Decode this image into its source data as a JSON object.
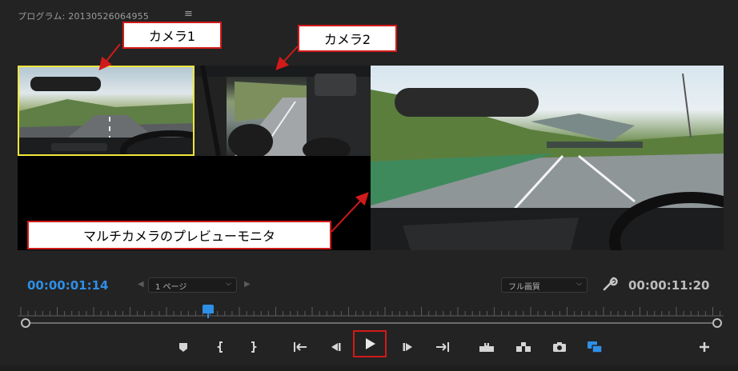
{
  "panel": {
    "title": "プログラム: 20130526064955",
    "menu_icon": "hamburger-menu-icon"
  },
  "callouts": {
    "camera1": "カメラ1",
    "camera2": "カメラ2",
    "multicam_preview": "マルチカメラのプレビューモニタ"
  },
  "timecode": {
    "current": "00:00:01:14",
    "duration": "00:00:11:20"
  },
  "page_select": {
    "value": "1 ページ"
  },
  "quality_select": {
    "value": "フル画質"
  },
  "playhead": {
    "position_fraction": 0.27
  },
  "controls": [
    {
      "name": "add-marker-button",
      "icon": "marker-icon"
    },
    {
      "name": "mark-in-button",
      "icon": "mark-in-icon"
    },
    {
      "name": "mark-out-button",
      "icon": "mark-out-icon"
    },
    {
      "name": "go-to-in-button",
      "icon": "go-to-in-icon"
    },
    {
      "name": "step-back-button",
      "icon": "step-back-icon"
    },
    {
      "name": "play-button",
      "icon": "play-icon",
      "highlighted": true
    },
    {
      "name": "step-forward-button",
      "icon": "step-forward-icon"
    },
    {
      "name": "go-to-out-button",
      "icon": "go-to-out-icon"
    },
    {
      "name": "lift-button",
      "icon": "lift-icon"
    },
    {
      "name": "extract-button",
      "icon": "extract-icon"
    },
    {
      "name": "export-frame-button",
      "icon": "camera-icon"
    },
    {
      "name": "multicam-toggle-button",
      "icon": "multicam-icon",
      "active": true
    },
    {
      "name": "button-editor-button",
      "icon": "plus-icon"
    }
  ],
  "colors": {
    "accent": "#2f8fe6",
    "callout_border": "#d11a1a",
    "camera1_highlight": "#f0e63c",
    "background": "#232323"
  }
}
